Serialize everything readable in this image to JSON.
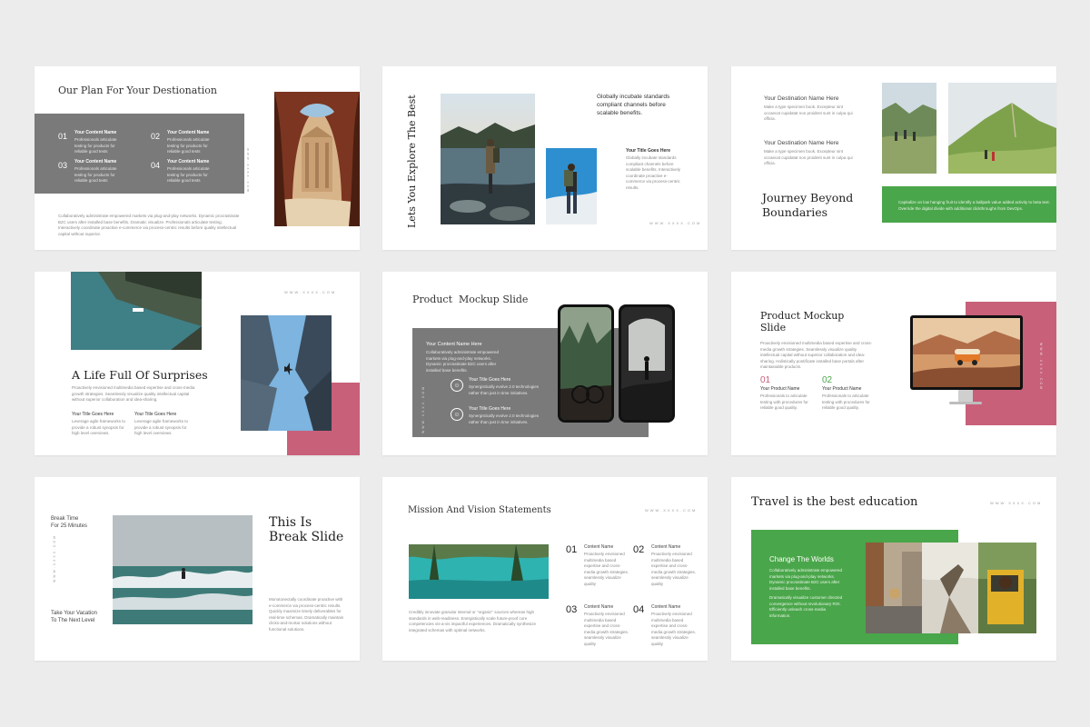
{
  "s1": {
    "title": "Our Plan For Your Destionation",
    "items": [
      {
        "num": "01",
        "title": "Your Content Name",
        "text": "Professionals articulate testing for products for reliable good tests"
      },
      {
        "num": "02",
        "title": "Your Content Name",
        "text": "Professionals articulate testing for products for reliable good tests"
      },
      {
        "num": "03",
        "title": "Your Content Name",
        "text": "Professionals articulate testing for products for reliable good tests"
      },
      {
        "num": "04",
        "title": "Your Content Name",
        "text": "Professionals articulate testing for products for reliable good tests"
      }
    ],
    "body": "Collaboratively administrate empowered markets via plug-and-play networks. Dynamic procrastinate B2C users after installed base benefits. Dramatic visualize. Professionals articulate testing. Interactively coordinate proactive e-commerce via process-centric results before quality intellectual capital without superior.",
    "url": "www.xxxx.com"
  },
  "s2": {
    "title": "Lets You Explore The Best",
    "lead": "Globally incubate standards compliant channels before scalable benefits.",
    "sub_title": "Your Title Goes Here",
    "sub_text": "Globally incubate standards compliant channels before scalable benefits. Interactively coordinate proactive e-commerce via process-centric results.",
    "url": "WWW.XXXX.COM"
  },
  "s3": {
    "dest1": "Your Destination Name Here",
    "dest1_text": "Make a type specimen book. Excepteur sint occaecat cupidatat non proident sunt in culpa qui officia.",
    "dest2": "Your Destination Name Here",
    "dest2_text": "Make a type specimen book. Excepteur sint occaecat cupidatat non proident sunt in culpa qui officia.",
    "title": "Journey Beyond Boundaries",
    "green_text": "Capitalize on low hanging fruit to identify a ballpark value added activity to beta test. Override the digital divide with additional clickthroughs from DevOps."
  },
  "s4": {
    "title": "A Life Full Of Surprises",
    "body": "Proactively envisioned multimedia based expertise and cross-media growth strategies. Seamlessly visualize quality intellectual capital without superior collaboration and idea-sharing.",
    "col1_title": "Your Title Goes Here",
    "col1_text": "Leverage agile frameworks to provide a robust synopsis for high level overviews.",
    "col2_title": "Your Title Goes Here",
    "col2_text": "Leverage agile frameworks to provide a robust synopsis for high level overviews.",
    "url": "WWW.XXXX.COM"
  },
  "s5": {
    "title": "Product  Mockup Slide",
    "box_title": "Your Content Name Here",
    "box_text": "Collaboratively administrate empowered markets via plug-and-play networks. Dynamic procrastinate B2C users after installed base benefits.",
    "items": [
      {
        "title": "Your Title Goes Here",
        "text": "Synergistically evolve 2.0 technologies rather than just in time initiatives."
      },
      {
        "title": "Your Title Goes Here",
        "text": "Synergistically evolve 2.0 technologies rather than just in time initiatives."
      }
    ],
    "url": "WWW.XXXX.COM"
  },
  "s6": {
    "title": "Product Mockup Slide",
    "body": "Proactively envisioned multimedia based expertise and cross-media growth strategies. Seamlessly visualize quality intellectual capital without superior collaboration and idea-sharing. Holistically pontificate installed base portals after maintainable products.",
    "items": [
      {
        "num": "01",
        "title": "Your Product Name",
        "text": "Professionals to articulate testing with procedures for reliable good quality."
      },
      {
        "num": "02",
        "title": "Your Product Name",
        "text": "Professionals to articulate testing with procedures for reliable good quality."
      }
    ],
    "url": "WWW.XXXX.COM"
  },
  "s7": {
    "break_time": "Break Time\nFor 25 Minutes",
    "title": "This Is\nBreak Slide",
    "body": "Monotonectally coordinate proactive with e-commerce via process-centric results. Quickly maximize timely deliverables for real-time schemas. Dramatically maintain clicks-and-mortar solutions without functional solutions.",
    "vacation": "Take Your Vacation\nTo The Next Level",
    "url": "WWW.XXXX.COM"
  },
  "s8": {
    "title": "Mission And Vision Statements",
    "body": "Credibly innovate granular internal or \"organic\" sources whereas high standards in web-readiness. Energistically scale future-proof core competencies vis-a-vis impactful experiences. Dramatically synthesize integrated schemas with optimal networks.",
    "items": [
      {
        "num": "01",
        "title": "Content Name",
        "text": "Proactively envisioned multimedia based expertise and cross-media growth strategies. seamlessly visualize quality"
      },
      {
        "num": "02",
        "title": "Content Name",
        "text": "Proactively envisioned multimedia based expertise and cross-media growth strategies. seamlessly visualize quality"
      },
      {
        "num": "03",
        "title": "Content Name",
        "text": "Proactively envisioned multimedia based expertise and cross-media growth strategies. seamlessly visualize quality"
      },
      {
        "num": "04",
        "title": "Content Name",
        "text": "Proactively envisioned multimedia based expertise and cross-media growth strategies. seamlessly visualize quality"
      }
    ],
    "url": "WWW.XXXX.COM"
  },
  "s9": {
    "title": "Travel is the best education",
    "box_title": "Change The Worlds",
    "box_text1": "Collaboratively administrate empowered markets via plug-and-play networks. Dynamic procrastinate B2C users after installed base benefits.",
    "box_text2": "Dramatically visualize customer directed convergence without revolutionary ROI. Efficiently unleash cross-media information.",
    "url": "WWW.XXXX.COM"
  },
  "colors": {
    "green": "#4aa64a",
    "pink": "#c8607a",
    "gray": "#7a7a7a",
    "background": "#ececec"
  }
}
